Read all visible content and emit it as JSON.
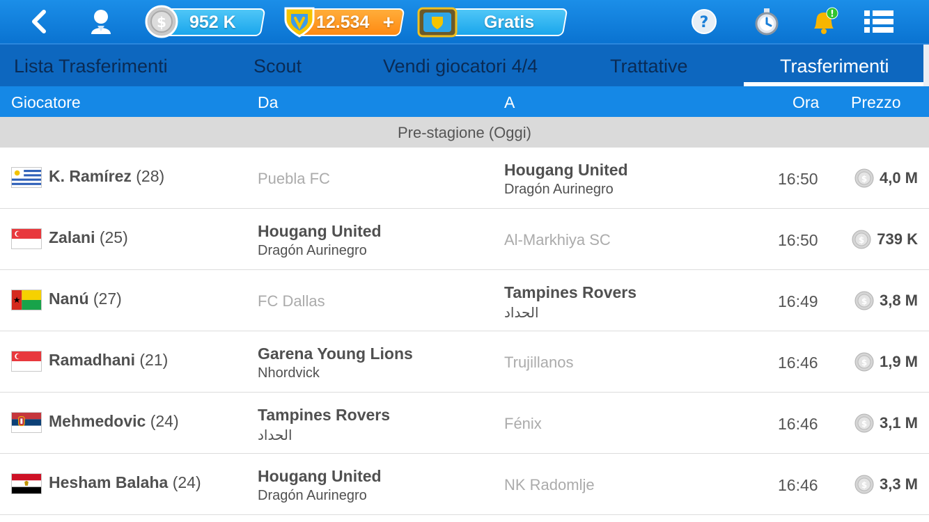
{
  "topbar": {
    "coins": "952 K",
    "tokens": "12.534",
    "tokens_plus": "+",
    "gratis": "Gratis"
  },
  "tabs": [
    {
      "label": "Lista Trasferimenti",
      "active": false
    },
    {
      "label": "Scout",
      "active": false
    },
    {
      "label": "Vendi giocatori 4/4",
      "active": false
    },
    {
      "label": "Trattative",
      "active": false
    },
    {
      "label": "Trasferimenti",
      "active": true
    }
  ],
  "columns": {
    "player": "Giocatore",
    "from": "Da",
    "to": "A",
    "time": "Ora",
    "price": "Prezzo"
  },
  "section": "Pre-stagione (Oggi)",
  "rows": [
    {
      "flag": "uruguay",
      "name": "K. Ramírez",
      "age": "(28)",
      "from": {
        "club": "Puebla FC",
        "manager": ""
      },
      "to": {
        "club": "Hougang United",
        "manager": "Dragón Aurinegro"
      },
      "time": "16:50",
      "price": "4,0 M"
    },
    {
      "flag": "singapore",
      "name": "Zalani",
      "age": "(25)",
      "from": {
        "club": "Hougang United",
        "manager": "Dragón Aurinegro"
      },
      "to": {
        "club": "Al-Markhiya SC",
        "manager": ""
      },
      "time": "16:50",
      "price": "739 K"
    },
    {
      "flag": "guinea-bissau",
      "name": "Nanú",
      "age": "(27)",
      "from": {
        "club": "FC Dallas",
        "manager": ""
      },
      "to": {
        "club": "Tampines Rovers",
        "manager": "الحداد"
      },
      "time": "16:49",
      "price": "3,8 M"
    },
    {
      "flag": "singapore",
      "name": "Ramadhani",
      "age": "(21)",
      "from": {
        "club": "Garena Young Lions",
        "manager": "Nhordvick"
      },
      "to": {
        "club": "Trujillanos",
        "manager": ""
      },
      "time": "16:46",
      "price": "1,9 M"
    },
    {
      "flag": "serbia",
      "name": "Mehmedovic",
      "age": "(24)",
      "from": {
        "club": "Tampines Rovers",
        "manager": "الحداد"
      },
      "to": {
        "club": "Fénix",
        "manager": ""
      },
      "time": "16:46",
      "price": "3,1 M"
    },
    {
      "flag": "egypt",
      "name": "Hesham Balaha",
      "age": "(24)",
      "from": {
        "club": "Hougang United",
        "manager": "Dragón Aurinegro"
      },
      "to": {
        "club": "NK Radomlje",
        "manager": ""
      },
      "time": "16:46",
      "price": "3,3 M"
    }
  ],
  "colors": {
    "topbar": "#0a73d1",
    "tabs_bg": "#0d67bf",
    "column_header": "#1588e6",
    "section_bg": "#dadada",
    "tokens_pill": "#ff8a12"
  }
}
